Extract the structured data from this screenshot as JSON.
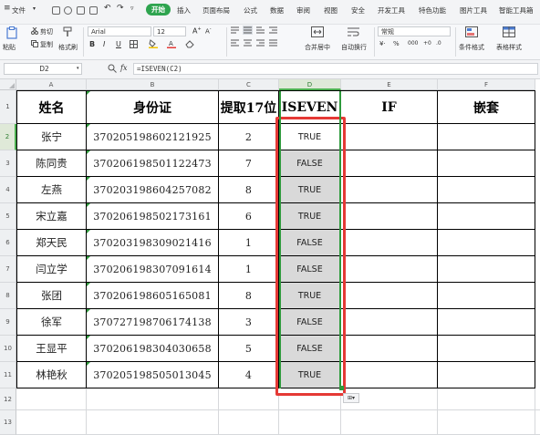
{
  "app": {
    "file_menu": "文件",
    "tabs": [
      "开始",
      "插入",
      "页面布局",
      "公式",
      "数据",
      "审阅",
      "视图",
      "安全",
      "开发工具",
      "特色功能",
      "图片工具",
      "智能工具箱"
    ],
    "active_tab": "开始"
  },
  "ribbon": {
    "paste": "粘贴",
    "cut": "剪切",
    "copy": "复制",
    "format_painter": "格式刷",
    "font_name": "Arial",
    "font_size": "12",
    "bold": "B",
    "italic": "I",
    "underline": "U",
    "merge_center": "合并居中",
    "wrap_text": "自动换行",
    "number_format": "常规",
    "percent_label": "%",
    "thousands_label": "000",
    "cond_format": "条件格式",
    "table_style": "表格样式"
  },
  "formula_bar": {
    "cell_ref": "D2",
    "fx": "fx",
    "formula": "=ISEVEN(C2)"
  },
  "sheet": {
    "columns": [
      "A",
      "B",
      "C",
      "D",
      "E",
      "F"
    ],
    "selected_column": "D",
    "row_numbers": [
      "1",
      "2",
      "3",
      "4",
      "5",
      "6",
      "7",
      "8",
      "9",
      "10",
      "11",
      "12",
      "13"
    ],
    "headers": [
      "姓名",
      "身份证",
      "提取17位",
      "ISEVEN",
      "IF",
      "嵌套"
    ],
    "rows": [
      {
        "name": "张宁",
        "id": "370205198602121925",
        "digit": "2",
        "iseven": "TRUE"
      },
      {
        "name": "陈同贵",
        "id": "370206198501122473",
        "digit": "7",
        "iseven": "FALSE"
      },
      {
        "name": "左燕",
        "id": "370203198604257082",
        "digit": "8",
        "iseven": "TRUE"
      },
      {
        "name": "宋立嘉",
        "id": "370206198502173161",
        "digit": "6",
        "iseven": "TRUE"
      },
      {
        "name": "郑天民",
        "id": "370203198309021416",
        "digit": "1",
        "iseven": "FALSE"
      },
      {
        "name": "闫立学",
        "id": "370206198307091614",
        "digit": "1",
        "iseven": "FALSE"
      },
      {
        "name": "张团",
        "id": "370206198605165081",
        "digit": "8",
        "iseven": "TRUE"
      },
      {
        "name": "徐军",
        "id": "370727198706174138",
        "digit": "3",
        "iseven": "FALSE"
      },
      {
        "name": "王显平",
        "id": "370206198304030658",
        "digit": "5",
        "iseven": "FALSE"
      },
      {
        "name": "林艳秋",
        "id": "370205198505013045",
        "digit": "4",
        "iseven": "TRUE"
      }
    ]
  },
  "highlight_color": "#e53935",
  "selection_color": "#2e9a3c"
}
